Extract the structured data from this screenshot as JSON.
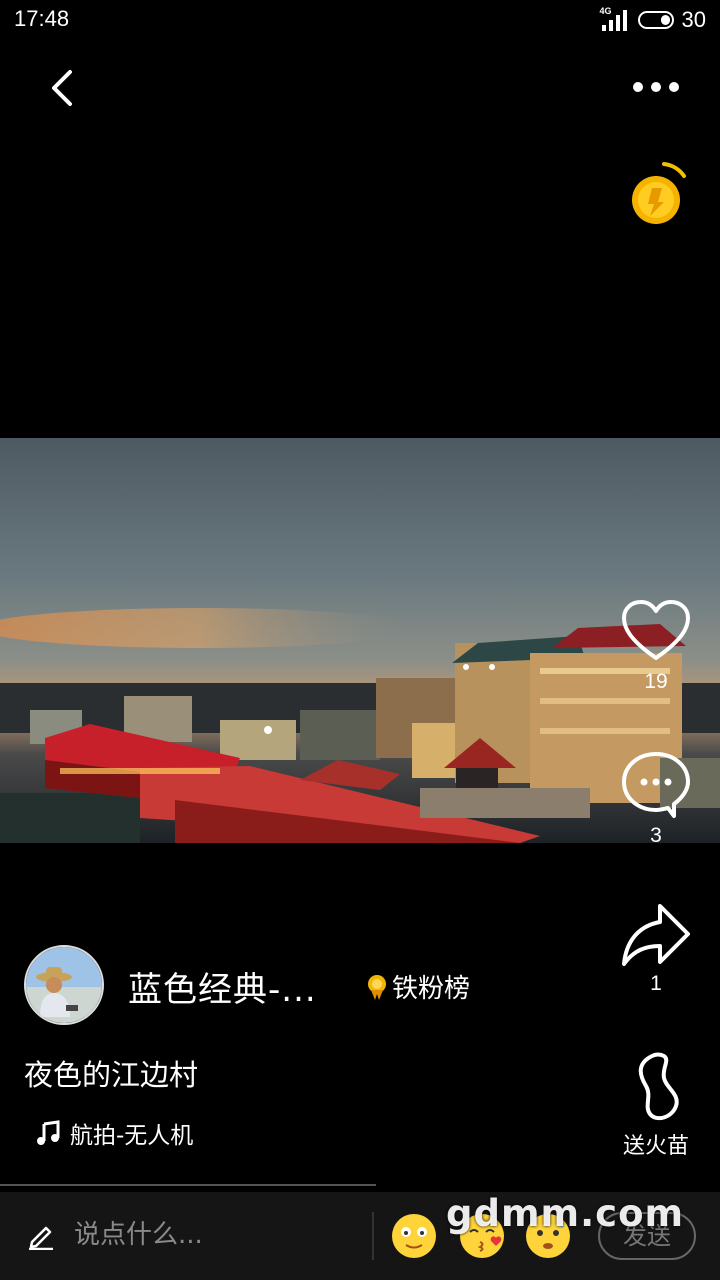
{
  "status_bar": {
    "time": "17:48",
    "network": "4G",
    "battery": "30"
  },
  "icons": {
    "back": "chevron-left-icon",
    "more": "more-dots-icon",
    "coin": "gold-coin-icon",
    "like": "heart-icon",
    "comment": "comment-bubble-icon",
    "share": "share-arrow-icon",
    "gift": "fire-sprout-icon",
    "music": "music-note-icon",
    "edit": "pencil-icon",
    "rank": "medal-icon"
  },
  "actions": {
    "like_count": "19",
    "comment_count": "3",
    "share_count": "1",
    "gift_label": "送火苗"
  },
  "author": {
    "name": "蓝色经典-...",
    "fan_rank_label": "铁粉榜"
  },
  "post": {
    "caption": "夜色的江边村",
    "music": "航拍-无人机"
  },
  "comment_bar": {
    "placeholder": "说点什么...",
    "send_label": "发送"
  },
  "watermark": "gdmm.com",
  "colors": {
    "background": "#000000",
    "coin": "#f5b800",
    "send_border": "#666666"
  }
}
